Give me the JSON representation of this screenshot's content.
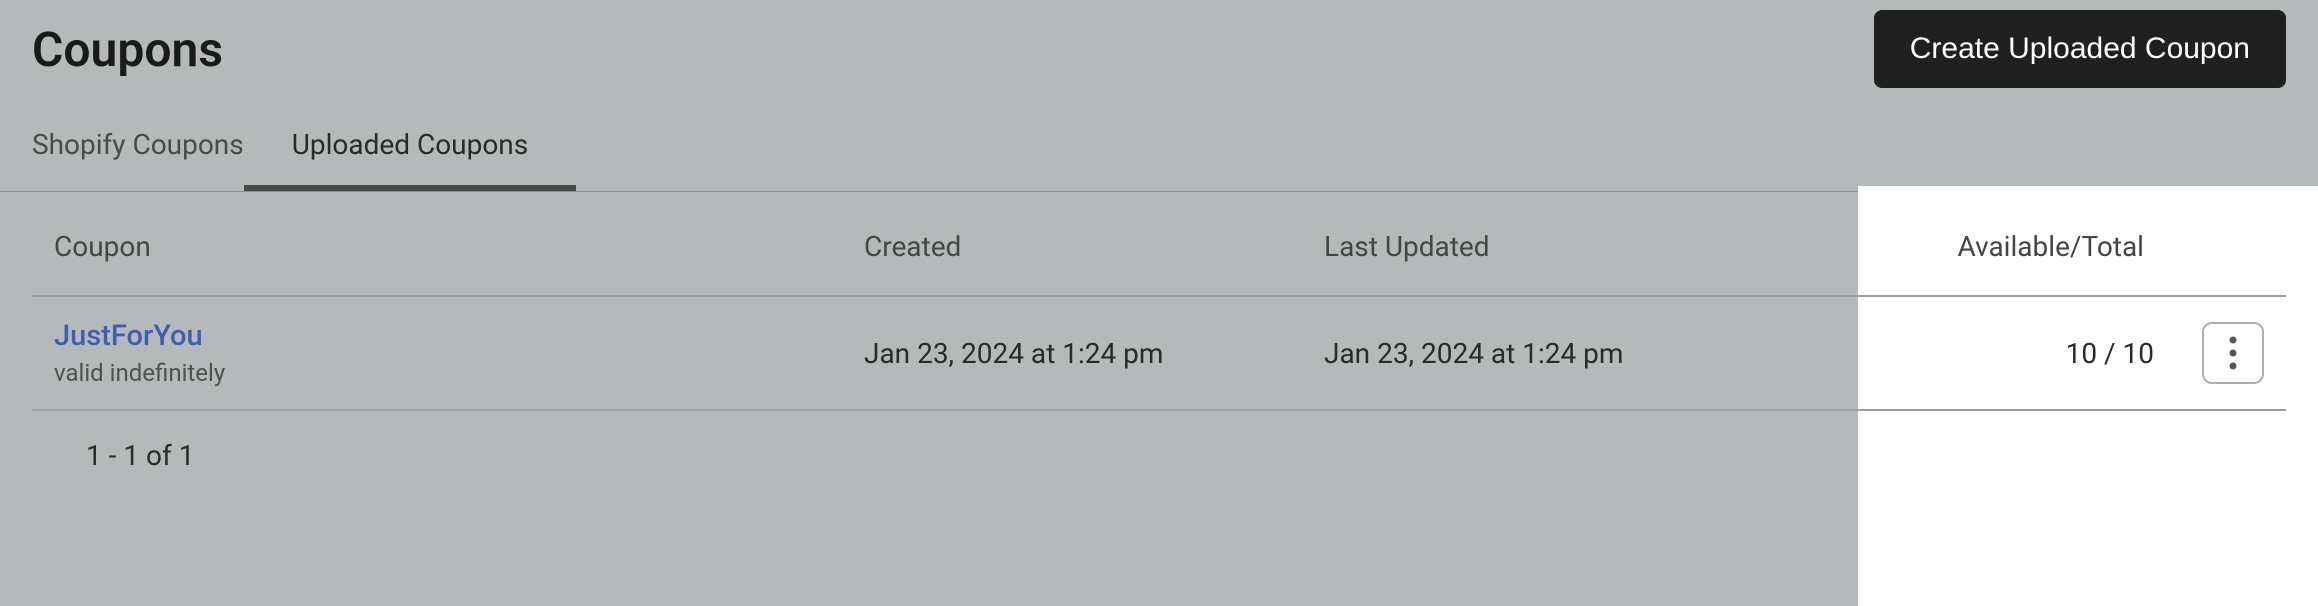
{
  "header": {
    "title": "Coupons",
    "create_button": "Create Uploaded Coupon"
  },
  "tabs": [
    {
      "label": "Shopify Coupons",
      "active": false
    },
    {
      "label": "Uploaded Coupons",
      "active": true
    }
  ],
  "table": {
    "headers": {
      "coupon": "Coupon",
      "created": "Created",
      "updated": "Last Updated",
      "available": "Available/Total"
    },
    "rows": [
      {
        "name": "JustForYou",
        "validity": "valid indefinitely",
        "created": "Jan 23, 2024 at 1:24 pm",
        "updated": "Jan 23, 2024 at 1:24 pm",
        "available_total": "10 / 10"
      }
    ]
  },
  "pagination": "1 - 1 of 1"
}
